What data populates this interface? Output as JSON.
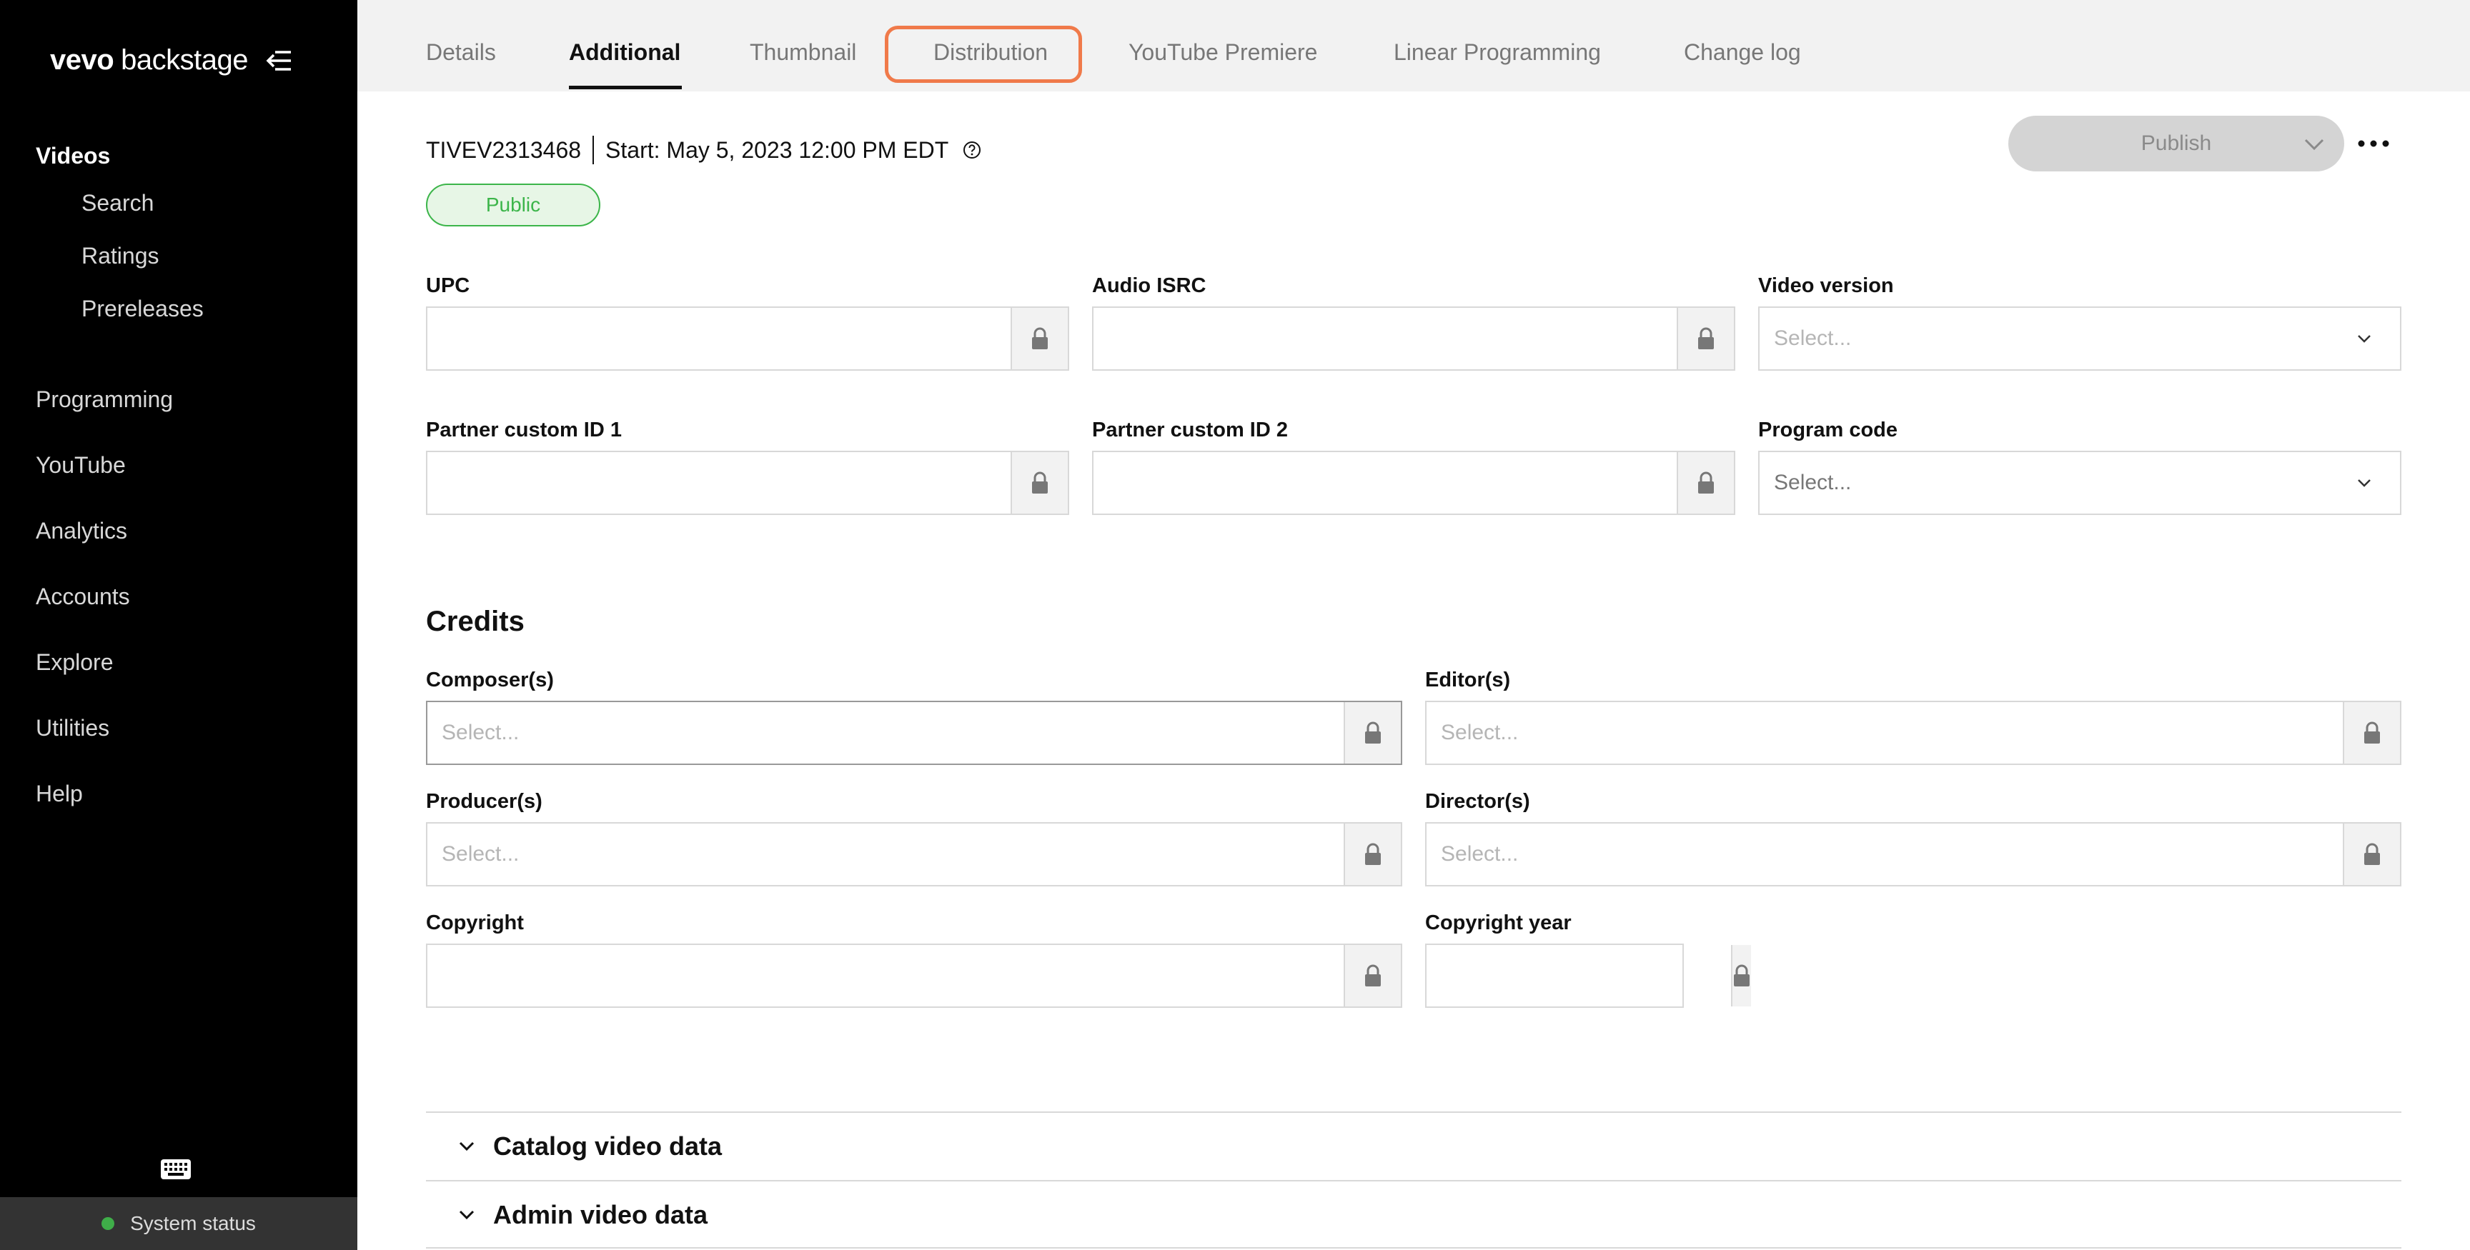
{
  "brand": {
    "name_part1": "vevo",
    "name_part2": "backstage"
  },
  "sidebar": {
    "section": "Videos",
    "sub_items": [
      "Search",
      "Ratings",
      "Prereleases"
    ],
    "items": [
      "Programming",
      "YouTube",
      "Analytics",
      "Accounts",
      "Explore",
      "Utilities",
      "Help"
    ],
    "system_status": "System status",
    "status_color": "#3fae49"
  },
  "tabs": [
    "Details",
    "Additional",
    "Thumbnail",
    "Distribution",
    "YouTube Premiere",
    "Linear Programming",
    "Change log"
  ],
  "active_tab": "Additional",
  "header": {
    "video_id": "TIVEV2313468",
    "start": "Start: May 5, 2023 12:00 PM EDT",
    "publish_label": "Publish",
    "status_badge": "Public"
  },
  "fields": {
    "upc": {
      "label": "UPC",
      "value": ""
    },
    "audio_isrc": {
      "label": "Audio ISRC",
      "value": ""
    },
    "video_version": {
      "label": "Video version",
      "placeholder": "Select..."
    },
    "partner_id_1": {
      "label": "Partner custom ID 1",
      "value": ""
    },
    "partner_id_2": {
      "label": "Partner custom ID 2",
      "value": ""
    },
    "program_code": {
      "label": "Program code",
      "placeholder": "Select..."
    }
  },
  "credits": {
    "title": "Credits",
    "composers": {
      "label": "Composer(s)",
      "placeholder": "Select..."
    },
    "editors": {
      "label": "Editor(s)",
      "placeholder": "Select..."
    },
    "producers": {
      "label": "Producer(s)",
      "placeholder": "Select..."
    },
    "directors": {
      "label": "Director(s)",
      "placeholder": "Select..."
    },
    "copyright": {
      "label": "Copyright",
      "value": ""
    },
    "copyright_year": {
      "label": "Copyright year",
      "value": ""
    }
  },
  "accordions": [
    "Catalog video data",
    "Admin video data"
  ],
  "colors": {
    "accent": "#f07a4a",
    "public_green": "#3cb54a",
    "sidebar_bg": "#000000"
  }
}
